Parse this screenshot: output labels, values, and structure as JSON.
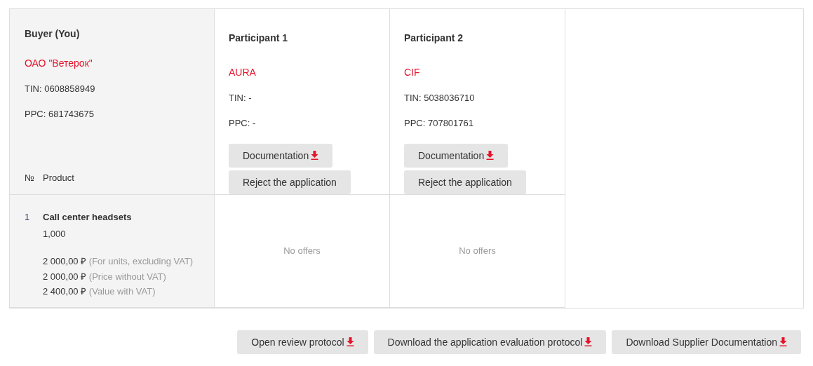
{
  "buyer": {
    "heading": "Buyer (You)",
    "company": "ОАО \"Ветерок\"",
    "tin": "TIN: 0608858949",
    "ppc": "PPC: 681743675"
  },
  "columns": {
    "number": "№",
    "product": "Product"
  },
  "participants": [
    {
      "heading": "Participant 1",
      "company": "AURA",
      "tin": "TIN: -",
      "ppc": "PPC: -",
      "buttons": [
        {
          "label": "Documentation",
          "kind": "download"
        },
        {
          "label": "Reject the application",
          "kind": "plain"
        }
      ],
      "offer": "No offers"
    },
    {
      "heading": "Participant 2",
      "company": "CIF",
      "tin": "TIN: 5038036710",
      "ppc": "PPC: 707801761",
      "buttons": [
        {
          "label": "Documentation",
          "kind": "download"
        },
        {
          "label": "Reject the application",
          "kind": "plain"
        }
      ],
      "offer": "No offers"
    }
  ],
  "products": [
    {
      "number": "1",
      "name": "Call center headsets",
      "quantity": "1,000",
      "prices": [
        {
          "amount": "2 000,00 ₽",
          "note": "(For units, excluding VAT)"
        },
        {
          "amount": "2 000,00 ₽",
          "note": "(Price without VAT)"
        },
        {
          "amount": "2 400,00 ₽",
          "note": "(Value with VAT)"
        }
      ]
    }
  ],
  "footer_buttons": [
    {
      "label": "Open review protocol",
      "kind": "download"
    },
    {
      "label": "Download the application evaluation protocol",
      "kind": "download"
    },
    {
      "label": "Download Supplier Documentation",
      "kind": "download"
    }
  ]
}
